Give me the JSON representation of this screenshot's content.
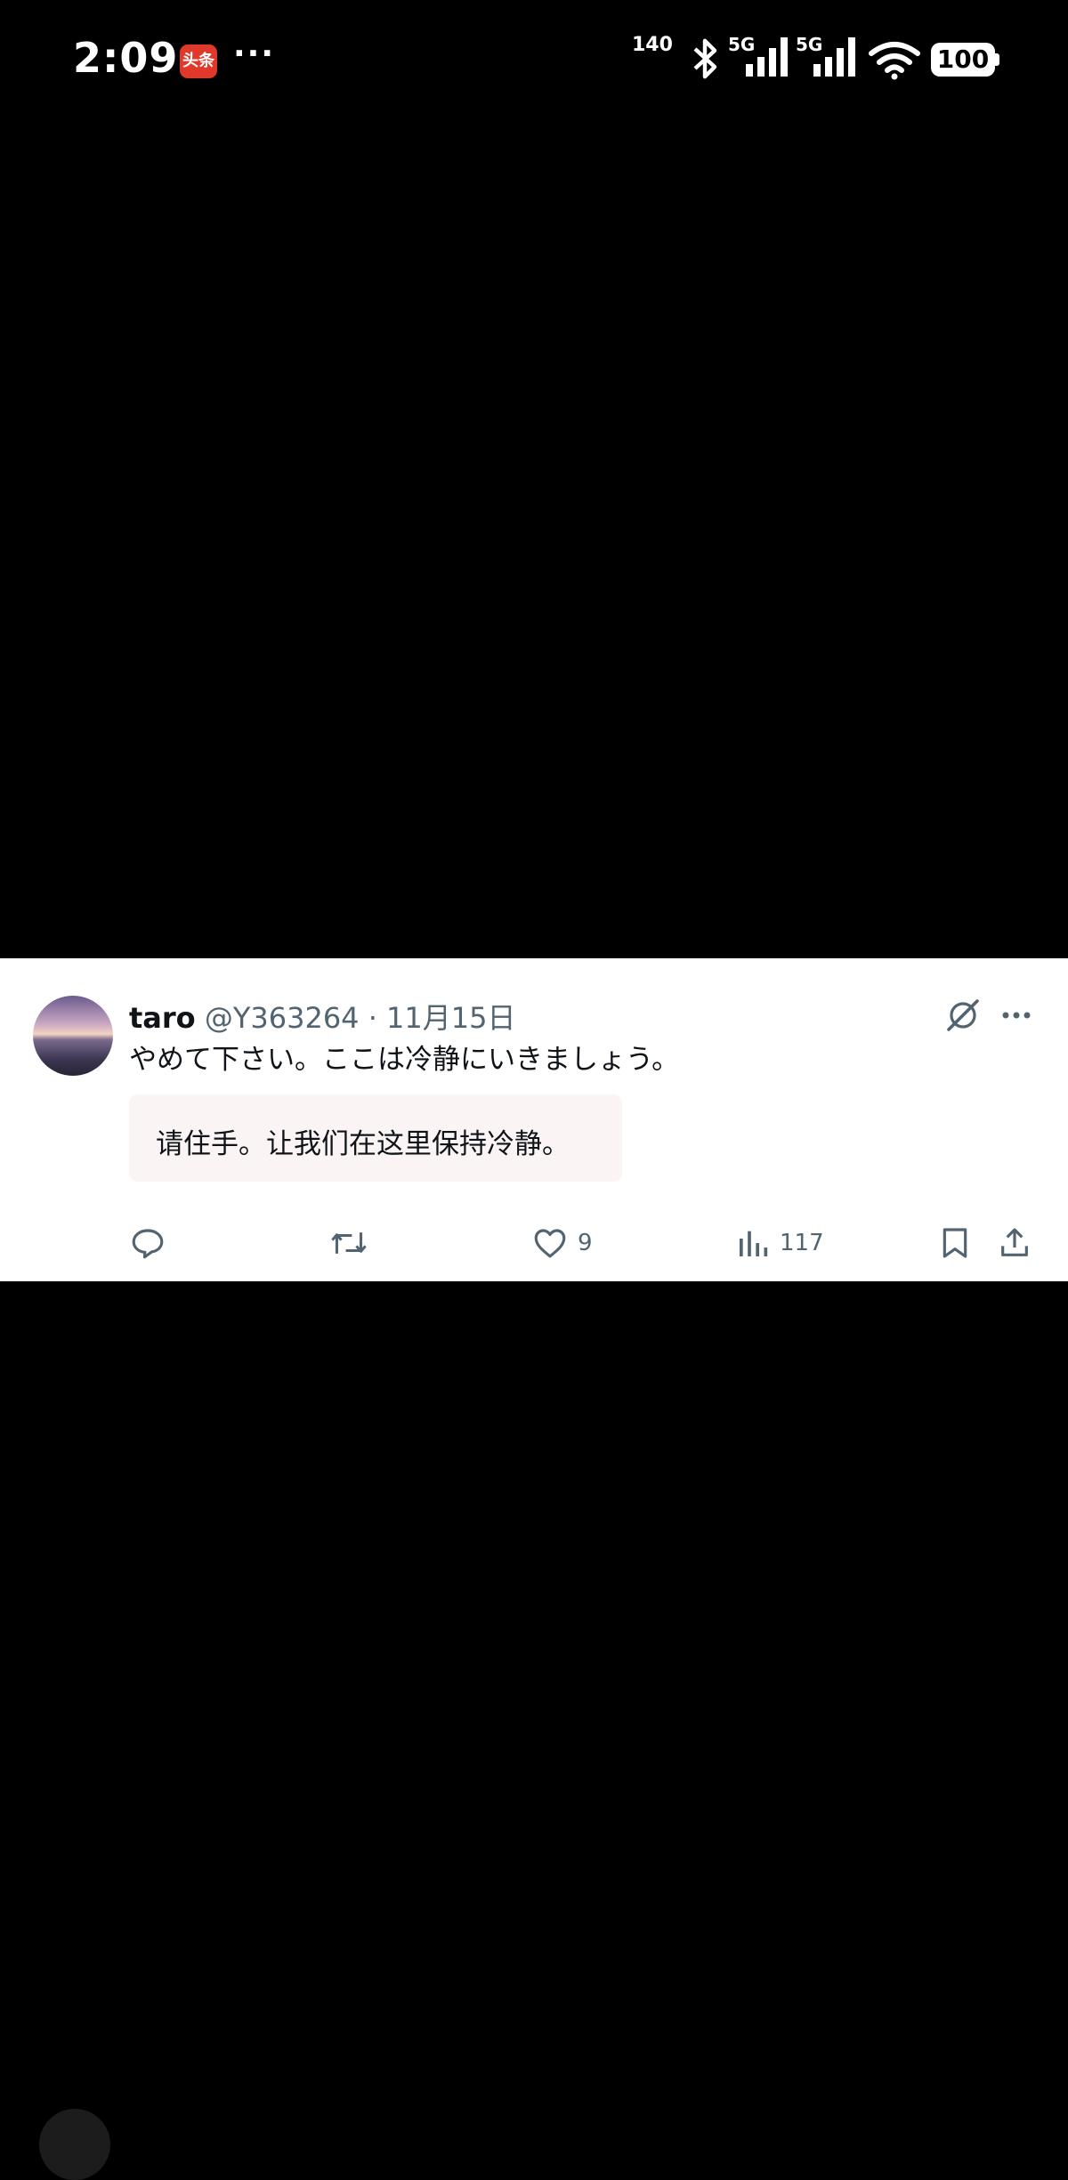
{
  "status_bar": {
    "time": "2:09",
    "app_badge": "头条",
    "more": "···",
    "net_speed": "140",
    "signal_1_label": "5G",
    "signal_2_label": "5G",
    "battery": "100"
  },
  "post": {
    "display_name": "taro",
    "handle": "@Y363264",
    "separator": " · ",
    "date": "11月15日",
    "text": "やめて下さい。ここは冷静にいきましょう。",
    "translation": "请住手。让我们在这里保持冷静。",
    "actions": {
      "reply_count": "",
      "repost_count": "",
      "like_count": "9",
      "view_count": "117"
    }
  },
  "icons": {
    "reply": "reply-icon",
    "repost": "repost-icon",
    "like": "heart-icon",
    "views": "views-icon",
    "bookmark": "bookmark-icon",
    "share": "share-icon",
    "grok": "grok-icon",
    "more": "more-icon"
  }
}
